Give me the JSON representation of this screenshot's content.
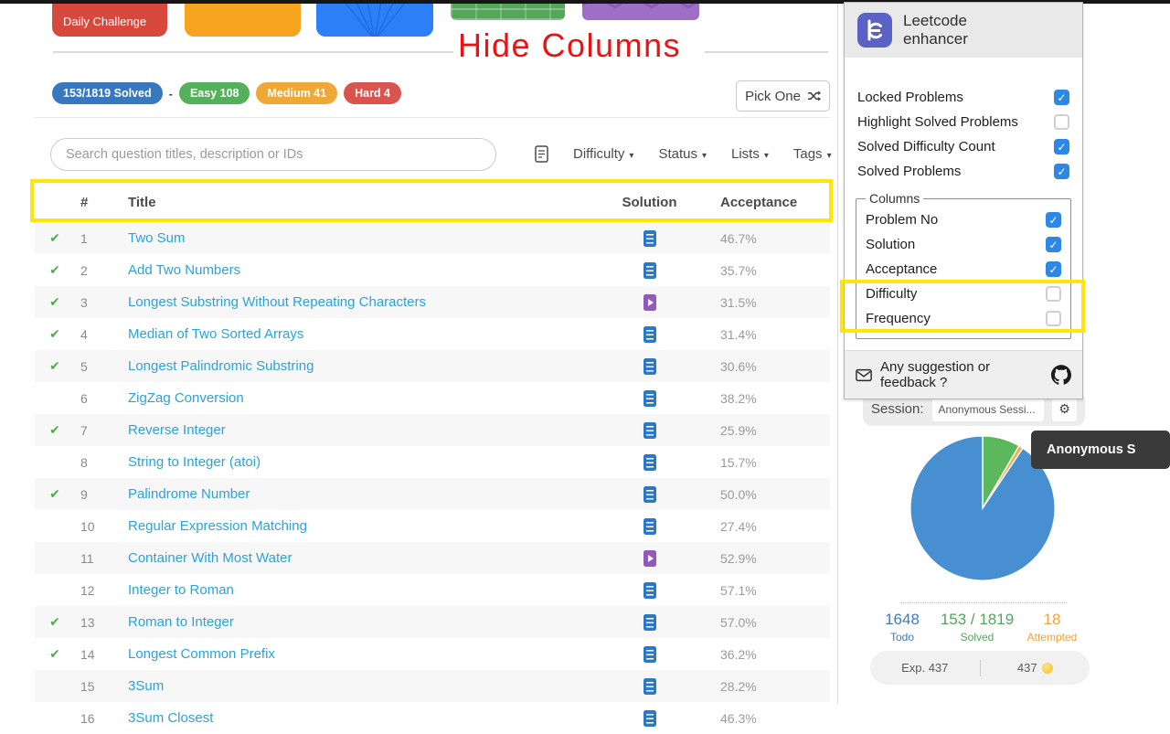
{
  "annotation_title": "Hide Columns",
  "top_cards": {
    "daily_challenge_label": "Daily Challenge"
  },
  "summary": {
    "solved_badge": "153/1819 Solved",
    "separator": "-",
    "easy_badge": "Easy 108",
    "medium_badge": "Medium 41",
    "hard_badge": "Hard 4",
    "pick_one_label": "Pick One"
  },
  "filters": {
    "search_placeholder": "Search question titles, description or IDs",
    "dropdowns": [
      "Difficulty",
      "Status",
      "Lists",
      "Tags"
    ]
  },
  "problems_table": {
    "headers": {
      "number": "#",
      "title": "Title",
      "solution": "Solution",
      "acceptance": "Acceptance"
    },
    "rows": [
      {
        "num": 1,
        "title": "Two Sum",
        "solved": true,
        "solution": "article",
        "acceptance": "46.7%"
      },
      {
        "num": 2,
        "title": "Add Two Numbers",
        "solved": true,
        "solution": "article",
        "acceptance": "35.7%"
      },
      {
        "num": 3,
        "title": "Longest Substring Without Repeating Characters",
        "solved": true,
        "solution": "video",
        "acceptance": "31.5%"
      },
      {
        "num": 4,
        "title": "Median of Two Sorted Arrays",
        "solved": true,
        "solution": "article",
        "acceptance": "31.4%"
      },
      {
        "num": 5,
        "title": "Longest Palindromic Substring",
        "solved": true,
        "solution": "article",
        "acceptance": "30.6%"
      },
      {
        "num": 6,
        "title": "ZigZag Conversion",
        "solved": false,
        "solution": "article",
        "acceptance": "38.2%"
      },
      {
        "num": 7,
        "title": "Reverse Integer",
        "solved": true,
        "solution": "article",
        "acceptance": "25.9%"
      },
      {
        "num": 8,
        "title": "String to Integer (atoi)",
        "solved": false,
        "solution": "article",
        "acceptance": "15.7%"
      },
      {
        "num": 9,
        "title": "Palindrome Number",
        "solved": true,
        "solution": "article",
        "acceptance": "50.0%"
      },
      {
        "num": 10,
        "title": "Regular Expression Matching",
        "solved": false,
        "solution": "article",
        "acceptance": "27.4%"
      },
      {
        "num": 11,
        "title": "Container With Most Water",
        "solved": false,
        "solution": "video",
        "acceptance": "52.9%"
      },
      {
        "num": 12,
        "title": "Integer to Roman",
        "solved": false,
        "solution": "article",
        "acceptance": "57.1%"
      },
      {
        "num": 13,
        "title": "Roman to Integer",
        "solved": true,
        "solution": "article",
        "acceptance": "57.0%"
      },
      {
        "num": 14,
        "title": "Longest Common Prefix",
        "solved": true,
        "solution": "article",
        "acceptance": "36.2%"
      },
      {
        "num": 15,
        "title": "3Sum",
        "solved": false,
        "solution": "article",
        "acceptance": "28.2%"
      },
      {
        "num": 16,
        "title": "3Sum Closest",
        "solved": false,
        "solution": "article",
        "acceptance": "46.3%"
      }
    ]
  },
  "extension_panel": {
    "name_line1": "Leetcode",
    "name_line2": "enhancer",
    "options": [
      {
        "label": "Locked Problems",
        "checked": true
      },
      {
        "label": "Highlight Solved Problems",
        "checked": false
      },
      {
        "label": "Solved Difficulty Count",
        "checked": true
      },
      {
        "label": "Solved Problems",
        "checked": true
      }
    ],
    "columns_group": {
      "legend": "Columns",
      "items": [
        {
          "label": "Problem No",
          "checked": true
        },
        {
          "label": "Solution",
          "checked": true
        },
        {
          "label": "Acceptance",
          "checked": true
        },
        {
          "label": "Difficulty",
          "checked": false
        },
        {
          "label": "Frequency",
          "checked": false
        }
      ]
    },
    "feedback_text": "Any suggestion or feedback ?"
  },
  "session": {
    "label": "Session:",
    "value": "Anonymous Sessi...",
    "tooltip": "Anonymous S"
  },
  "progress_stats": [
    {
      "value": "1648",
      "label": "Todo",
      "color": "#3d7cbf"
    },
    {
      "value": "153 / 1819",
      "label": "Solved",
      "color": "#52a65c"
    },
    {
      "value": "18",
      "label": "Attempted",
      "color": "#f0a33c"
    }
  ],
  "exp_bar": {
    "left": "Exp. 437",
    "right": "437"
  },
  "chart_data": {
    "type": "pie",
    "slices": [
      {
        "label": "Solved",
        "value": 153,
        "color": "#5cb85c"
      },
      {
        "label": "Attempted",
        "value": 18,
        "color": "#f0ad4e"
      },
      {
        "label": "Todo",
        "value": 1648,
        "color": "#478fd1"
      }
    ],
    "total": 1819,
    "start_angle": "top",
    "direction": "clockwise",
    "legend_position": "none"
  },
  "icons": {
    "solved_check": "✔",
    "checkbox_check": "✓",
    "caret_down": "▾",
    "gear": "⚙"
  },
  "colors": {
    "annotation_red": "#ee1111",
    "highlight_yellow": "#ffe60a",
    "link_blue": "#29a3d9",
    "checkbox_blue": "#2d87e4"
  }
}
